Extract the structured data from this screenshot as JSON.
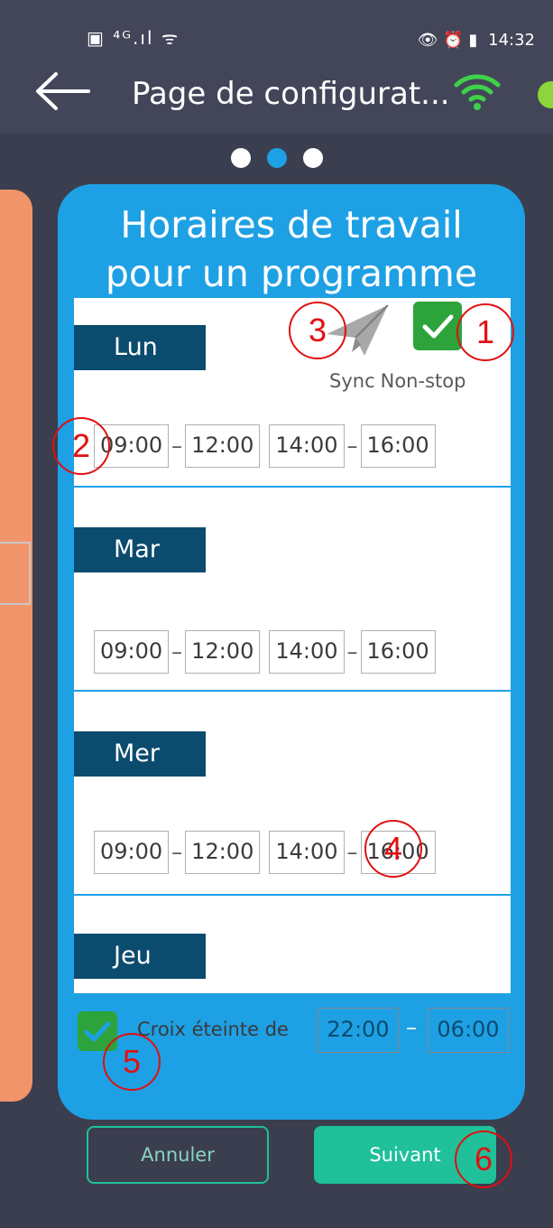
{
  "status": {
    "left_icons": "▣ ⁴ᴳ.ıl ᯤ",
    "right_icons": "👁 ⏰ ▮",
    "time": "14:32"
  },
  "appbar": {
    "title": "Page de configurat..."
  },
  "card": {
    "title_line1": "Horaires de travail",
    "title_line2": "pour un programme"
  },
  "options": {
    "sync_label": "Sync",
    "nonstop_label": "Non-stop"
  },
  "days": [
    {
      "label": "Lun",
      "times": [
        "09:00",
        "12:00",
        "14:00",
        "16:00"
      ]
    },
    {
      "label": "Mar",
      "times": [
        "09:00",
        "12:00",
        "14:00",
        "16:00"
      ]
    },
    {
      "label": "Mer",
      "times": [
        "09:00",
        "12:00",
        "14:00",
        "16:00"
      ]
    },
    {
      "label": "Jeu"
    }
  ],
  "dash": "–",
  "cross": {
    "label": "Croix éteinte de",
    "from": "22:00",
    "to": "06:00"
  },
  "buttons": {
    "cancel": "Annuler",
    "next": "Suivant"
  },
  "annotations": [
    "1",
    "2",
    "3",
    "4",
    "5",
    "6"
  ],
  "colors": {
    "card": "#1ea0e4",
    "day_label": "#0b4b6e",
    "button": "#1fc09a",
    "check": "#2ca43b",
    "annotation": "#e01010"
  }
}
